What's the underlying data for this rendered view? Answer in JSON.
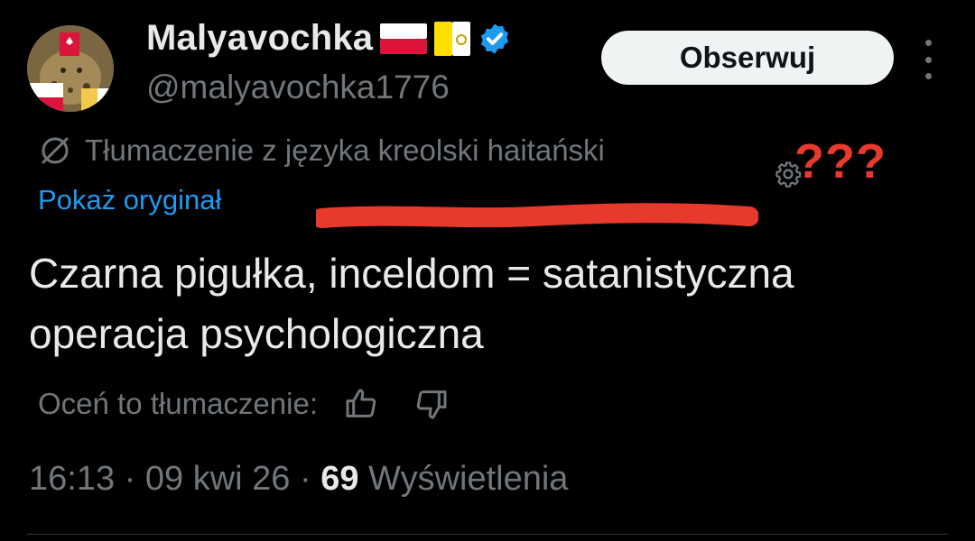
{
  "author": {
    "name": "Malyavochka",
    "handle": "@malyavochka1776",
    "verified": true,
    "flags": [
      "poland-flag",
      "vatican-flag"
    ]
  },
  "follow_label": "Obserwuj",
  "translation": {
    "notice": "Tłumaczenie z języka kreolski haitański",
    "show_original": "Pokaż oryginał",
    "annotation": "???"
  },
  "tweet": {
    "line1": "Czarna pigułka, inceldom = satanistyczna",
    "line2": "operacja psychologiczna"
  },
  "rating": {
    "label": "Oceń to tłumaczenie:"
  },
  "meta": {
    "time": "16:13",
    "date": "09 kwi 26",
    "views_count": "69",
    "views_label": "Wyświetlenia"
  },
  "colors": {
    "background": "#000000",
    "text": "#e7e9ea",
    "secondary": "#71767b",
    "link": "#1d9bf0",
    "verified": "#1d9bf0",
    "annotation_red": "#e83a2c"
  }
}
